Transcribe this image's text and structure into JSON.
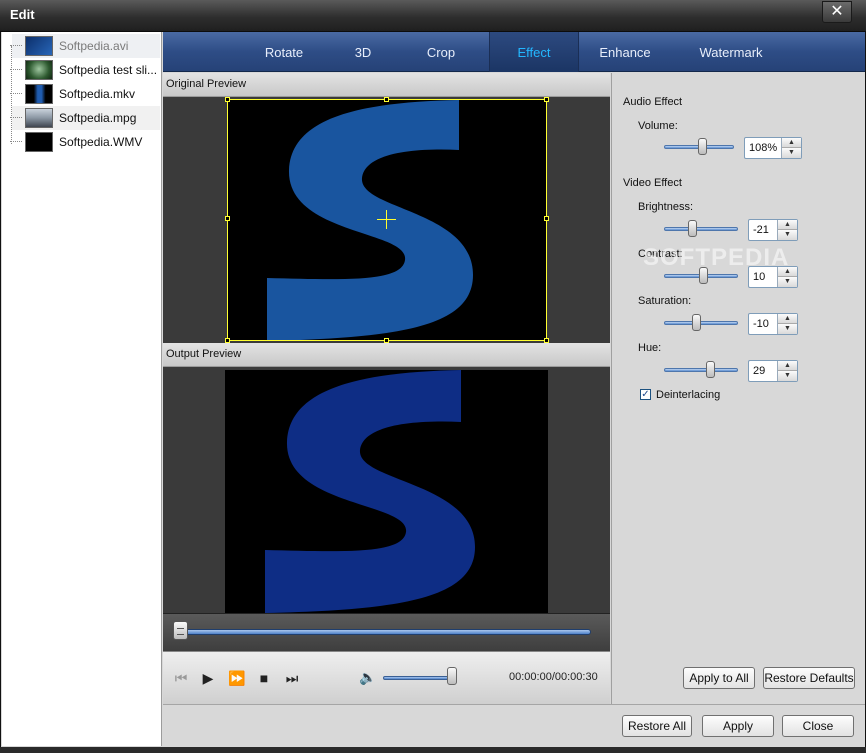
{
  "window": {
    "title": "Edit",
    "close_glyph": "✕"
  },
  "files": [
    {
      "name": "Softpedia.avi",
      "selected": true
    },
    {
      "name": "Softpedia test sli...",
      "selected": false
    },
    {
      "name": "Softpedia.mkv",
      "selected": false
    },
    {
      "name": "Softpedia.mpg",
      "selected": false
    },
    {
      "name": "Softpedia.WMV",
      "selected": false
    }
  ],
  "tabs": [
    "Rotate",
    "3D",
    "Crop",
    "Effect",
    "Enhance",
    "Watermark"
  ],
  "active_tab": "Effect",
  "preview": {
    "original_label": "Original Preview",
    "output_label": "Output Preview",
    "glyph": "S",
    "timecode": "00:00:00/00:00:30",
    "seek_position": 0.0,
    "volume_level": 0.9
  },
  "settings": {
    "audio_effect_label": "Audio Effect",
    "volume_label": "Volume:",
    "volume_value": "108%",
    "volume_fraction": 0.54,
    "video_effect_label": "Video Effect",
    "brightness_label": "Brightness:",
    "brightness_value": "-21",
    "contrast_label": "Contrast:",
    "contrast_value": "10",
    "saturation_label": "Saturation:",
    "saturation_value": "-10",
    "hue_label": "Hue:",
    "hue_value": "29",
    "deinterlacing_label": "Deinterlacing",
    "deinterlacing_checked": true,
    "apply_to_all_label": "Apply to All",
    "restore_defaults_label": "Restore Defaults"
  },
  "footer": {
    "restore_all_label": "Restore All",
    "apply_label": "Apply",
    "close_label": "Close"
  },
  "watermark_text": "SOFTPEDIA",
  "colors": {
    "tab_active_text": "#23b7ff",
    "crop_frame": "#ffff30",
    "logo_blue": "#1a5aa8",
    "output_blue": "#0e2d85"
  }
}
